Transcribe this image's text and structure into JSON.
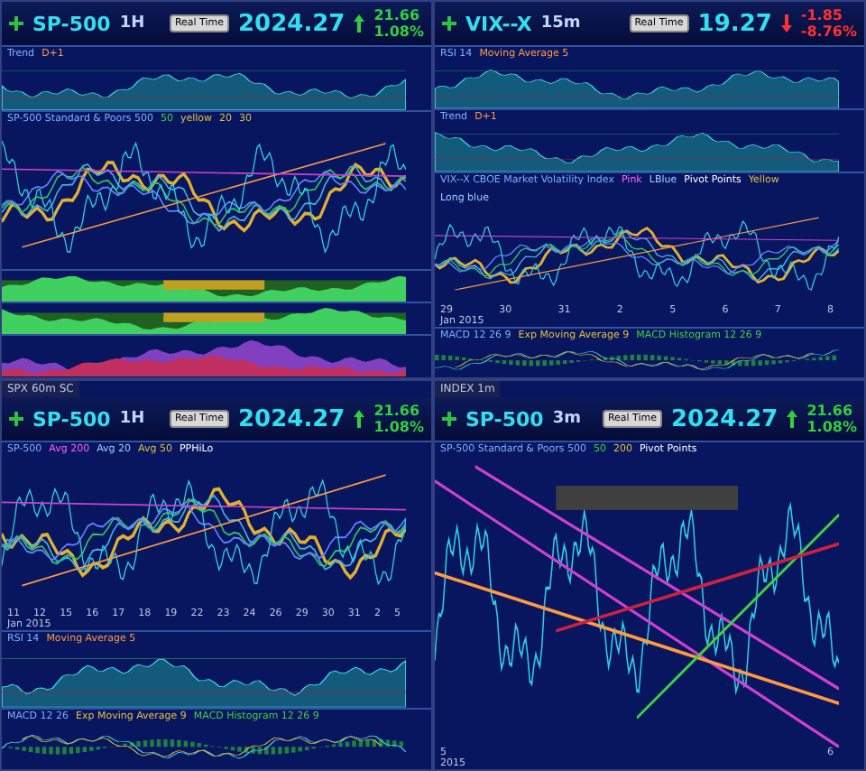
{
  "panels": [
    {
      "symbol": "SP-500",
      "interval": "1H",
      "button": "Real Time",
      "price": "2024.27",
      "change": "21.66",
      "change_pct": "1.08%",
      "rising": true,
      "panes": [
        {
          "kind": "area",
          "legend": [
            {
              "text": "Trend",
              "color": "#7fb0ff"
            },
            {
              "text": "D+1",
              "color": "#ff9a40"
            }
          ]
        },
        {
          "kind": "price",
          "legend": [
            {
              "text": "SP-500 Standard & Poors 500",
              "color": "#7fb0ff"
            },
            {
              "text": "50",
              "color": "#40d040"
            },
            {
              "text": "yellow",
              "color": "#e0c040"
            },
            {
              "text": "20",
              "color": "#e0c040"
            },
            {
              "text": "30",
              "color": "#e0c040"
            }
          ]
        },
        {
          "kind": "bands"
        },
        {
          "kind": "bands"
        },
        {
          "kind": "histogram"
        }
      ]
    },
    {
      "symbol": "VIX--X",
      "interval": "15m",
      "button": "Real Time",
      "price": "19.27",
      "change": "-1.85",
      "change_pct": "-8.76%",
      "rising": false,
      "panes": [
        {
          "kind": "area",
          "legend": [
            {
              "text": "RSI 14",
              "color": "#7fb0ff"
            },
            {
              "text": "Moving Average 5",
              "color": "#ff9a40"
            }
          ]
        },
        {
          "kind": "area",
          "legend": [
            {
              "text": "Trend",
              "color": "#7fb0ff"
            },
            {
              "text": "D+1",
              "color": "#ff9a40"
            }
          ]
        },
        {
          "kind": "price",
          "legend": [
            {
              "text": "VIX--X CBOE Market Volatility Index",
              "color": "#7fb0ff"
            },
            {
              "text": "Pink",
              "color": "#ff60ff"
            },
            {
              "text": "LBlue",
              "color": "#a0d0ff"
            },
            {
              "text": "Pivot Points",
              "color": "#ffffff"
            },
            {
              "text": "Yellow",
              "color": "#e0c040"
            },
            {
              "text": "Long blue",
              "color": "#a0d0ff"
            }
          ],
          "x_labels": [
            "29",
            "30",
            "31",
            "2",
            "5",
            "6",
            "7",
            "8"
          ],
          "x_caption": "Jan 2015"
        },
        {
          "kind": "macd",
          "legend": [
            {
              "text": "MACD 12 26 9",
              "color": "#7fb0ff"
            },
            {
              "text": "Exp Moving Average 9",
              "color": "#e0c040"
            },
            {
              "text": "MACD Histogram 12 26 9",
              "color": "#40d040"
            }
          ]
        }
      ]
    },
    {
      "window_label": "SPX 60m SC",
      "symbol": "SP-500",
      "interval": "1H",
      "button": "Real Time",
      "price": "2024.27",
      "change": "21.66",
      "change_pct": "1.08%",
      "rising": true,
      "panes": [
        {
          "kind": "price",
          "legend": [
            {
              "text": "SP-500",
              "color": "#7fb0ff"
            },
            {
              "text": "Avg 200",
              "color": "#ff60ff"
            },
            {
              "text": "Avg 20",
              "color": "#a0d0ff"
            },
            {
              "text": "Avg 50",
              "color": "#e0c040"
            },
            {
              "text": "PPHiLo",
              "color": "#ffffff"
            }
          ],
          "x_labels": [
            "11",
            "12",
            "15",
            "16",
            "17",
            "18",
            "19",
            "22",
            "23",
            "24",
            "26",
            "29",
            "30",
            "31",
            "2",
            "5"
          ],
          "x_caption": "Jan 2015"
        },
        {
          "kind": "area",
          "legend": [
            {
              "text": "RSI 14",
              "color": "#7fb0ff"
            },
            {
              "text": "Moving Average 5",
              "color": "#ff9a40"
            }
          ]
        },
        {
          "kind": "macd",
          "legend": [
            {
              "text": "MACD 12 26",
              "color": "#7fb0ff"
            },
            {
              "text": "Exp Moving Average 9",
              "color": "#e0c040"
            },
            {
              "text": "MACD Histogram 12 26 9",
              "color": "#40d040"
            }
          ]
        }
      ]
    },
    {
      "window_label": "INDEX 1m",
      "symbol": "SP-500",
      "interval": "3m",
      "button": "Real Time",
      "price": "2024.27",
      "change": "21.66",
      "change_pct": "1.08%",
      "rising": true,
      "panes": [
        {
          "kind": "trend",
          "legend": [
            {
              "text": "SP-500 Standard & Poors 500",
              "color": "#7fb0ff"
            },
            {
              "text": "50",
              "color": "#40d040"
            },
            {
              "text": "200",
              "color": "#e0c040"
            },
            {
              "text": "Pivot Points",
              "color": "#ffffff"
            }
          ],
          "x_labels": [
            "5",
            "6"
          ],
          "x_caption": "2015"
        }
      ]
    }
  ]
}
